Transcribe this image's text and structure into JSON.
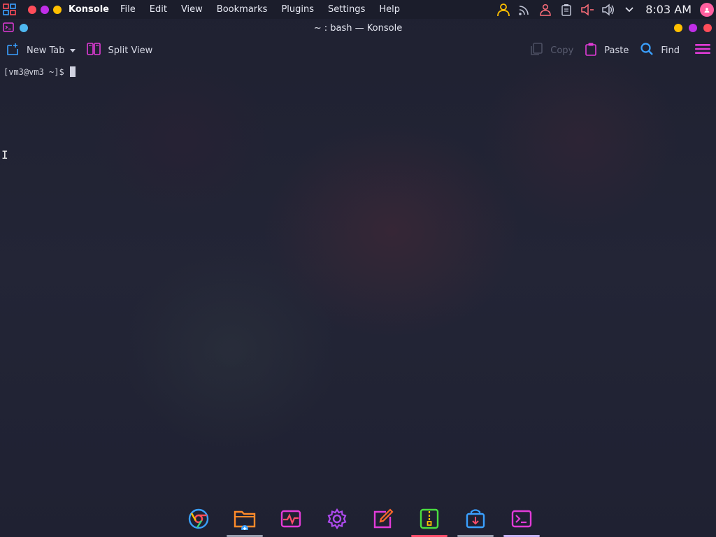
{
  "top_panel": {
    "app_name": "Konsole",
    "menu": [
      "File",
      "Edit",
      "View",
      "Bookmarks",
      "Plugins",
      "Settings",
      "Help"
    ],
    "clock": "8:03 AM",
    "tray_icons": [
      "user-icon",
      "rss-icon",
      "user-alert-icon",
      "clipboard-icon",
      "speaker-muted-icon",
      "volume-icon",
      "chevron-down-icon"
    ],
    "traffic_colors": [
      "#ff4d5a",
      "#c02ee8",
      "#ffc000"
    ]
  },
  "window": {
    "title": "~ : bash — Konsole",
    "controls_colors": [
      "#ffc000",
      "#c02ee8",
      "#ff4d5a"
    ]
  },
  "toolbar": {
    "new_tab": "New Tab",
    "split_view": "Split View",
    "copy": "Copy",
    "paste": "Paste",
    "find": "Find"
  },
  "terminal": {
    "prompt": "[vm3@vm3 ~]$"
  },
  "dock": {
    "items": [
      {
        "name": "chrome-icon",
        "indicator": ""
      },
      {
        "name": "files-icon",
        "indicator": "#9aa0b0"
      },
      {
        "name": "system-monitor-icon",
        "indicator": ""
      },
      {
        "name": "settings-icon",
        "indicator": ""
      },
      {
        "name": "text-editor-icon",
        "indicator": ""
      },
      {
        "name": "archive-manager-icon",
        "indicator": "#ff4d6a"
      },
      {
        "name": "software-store-icon",
        "indicator": "#9aa0b0"
      },
      {
        "name": "terminal-icon",
        "indicator": "#c7b3f5"
      }
    ]
  },
  "colors": {
    "accent_magenta": "#e23bd8",
    "accent_blue": "#3aa0ff",
    "panel_bg": "#1b1d2b",
    "desktop_bg": "#21233a"
  }
}
